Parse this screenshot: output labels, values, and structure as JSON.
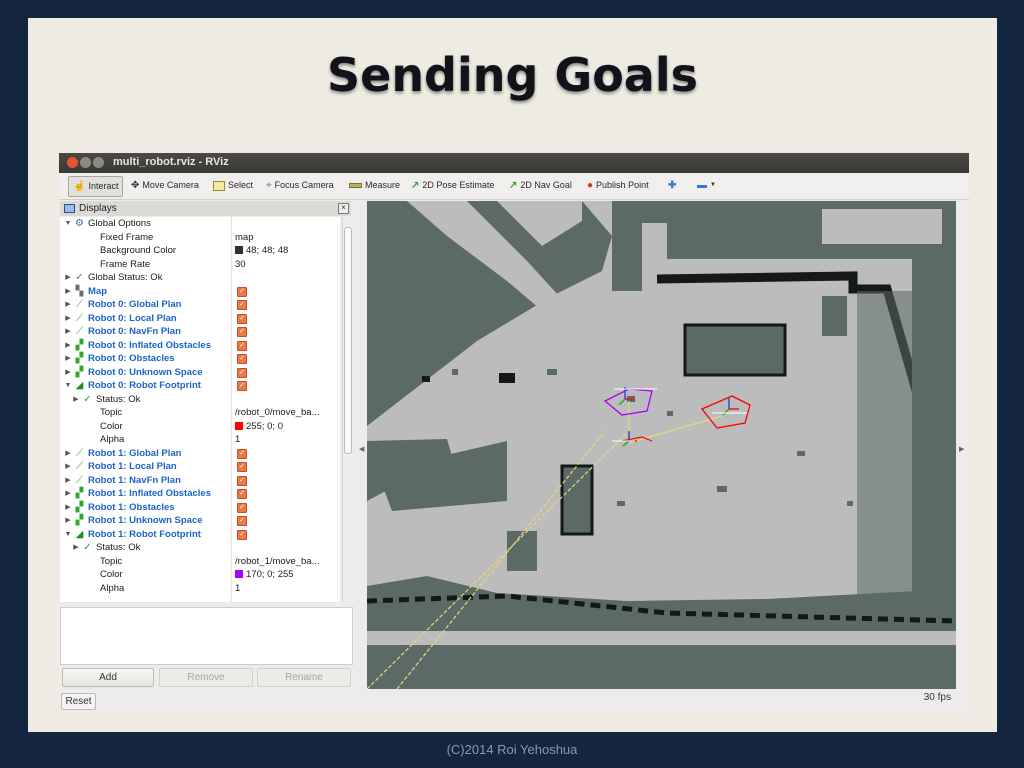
{
  "slide": {
    "title": "Sending Goals",
    "footer": "(C)2014 Roi Yehoshua"
  },
  "window": {
    "title": "multi_robot.rviz - RViz"
  },
  "toolbar": {
    "interact": "Interact",
    "move_camera": "Move Camera",
    "select": "Select",
    "focus_camera": "Focus Camera",
    "measure": "Measure",
    "pose_estimate": "2D Pose Estimate",
    "nav_goal": "2D Nav Goal",
    "publish_point": "Publish Point"
  },
  "displays": {
    "header": "Displays",
    "rows": [
      {
        "label": "Global Options",
        "icon": "gear-icon",
        "indent": 0,
        "arrow": "down",
        "blue": false
      },
      {
        "label": "Fixed Frame",
        "value": "map",
        "indent": 2
      },
      {
        "label": "Background Color",
        "value": "48; 48; 48",
        "swatch": "#303030",
        "indent": 2
      },
      {
        "label": "Frame Rate",
        "value": "30",
        "indent": 2
      },
      {
        "label": "Global Status: Ok",
        "icon": "check-icon",
        "indent": 0,
        "arrow": "right"
      },
      {
        "label": "Map",
        "icon": "map-icon",
        "indent": 0,
        "arrow": "right",
        "blue": true,
        "checked": true
      },
      {
        "label": "Robot 0: Global Plan",
        "icon": "path-icon",
        "indent": 0,
        "arrow": "right",
        "blue": true,
        "checked": true
      },
      {
        "label": "Robot 0: Local Plan",
        "icon": "path-icon",
        "indent": 0,
        "arrow": "right",
        "blue": true,
        "checked": true
      },
      {
        "label": "Robot 0: NavFn Plan",
        "icon": "path-icon",
        "indent": 0,
        "arrow": "right",
        "blue": true,
        "checked": true
      },
      {
        "label": "Robot 0: Inflated Obstacles",
        "icon": "grid-cells-icon",
        "indent": 0,
        "arrow": "right",
        "blue": true,
        "checked": true
      },
      {
        "label": "Robot 0: Obstacles",
        "icon": "grid-cells-icon",
        "indent": 0,
        "arrow": "right",
        "blue": true,
        "checked": true
      },
      {
        "label": "Robot 0: Unknown Space",
        "icon": "grid-cells-icon",
        "indent": 0,
        "arrow": "right",
        "blue": true,
        "checked": true
      },
      {
        "label": "Robot 0: Robot Footprint",
        "icon": "polygon-icon",
        "indent": 0,
        "arrow": "down",
        "blue": true,
        "checked": true
      },
      {
        "label": "Status: Ok",
        "icon": "check-icon",
        "indent": 1,
        "arrow": "right"
      },
      {
        "label": "Topic",
        "value": "/robot_0/move_ba...",
        "indent": 2
      },
      {
        "label": "Color",
        "value": "255; 0; 0",
        "swatch": "#ff0000",
        "indent": 2
      },
      {
        "label": "Alpha",
        "value": "1",
        "indent": 2
      },
      {
        "label": "Robot 1: Global Plan",
        "icon": "path-icon",
        "indent": 0,
        "arrow": "right",
        "blue": true,
        "checked": true
      },
      {
        "label": "Robot 1: Local Plan",
        "icon": "path-icon",
        "indent": 0,
        "arrow": "right",
        "blue": true,
        "checked": true
      },
      {
        "label": "Robot 1: NavFn Plan",
        "icon": "path-icon",
        "indent": 0,
        "arrow": "right",
        "blue": true,
        "checked": true
      },
      {
        "label": "Robot 1: Inflated Obstacles",
        "icon": "grid-cells-icon",
        "indent": 0,
        "arrow": "right",
        "blue": true,
        "checked": true
      },
      {
        "label": "Robot 1: Obstacles",
        "icon": "grid-cells-icon",
        "indent": 0,
        "arrow": "right",
        "blue": true,
        "checked": true
      },
      {
        "label": "Robot 1: Unknown Space",
        "icon": "grid-cells-icon",
        "indent": 0,
        "arrow": "right",
        "blue": true,
        "checked": true
      },
      {
        "label": "Robot 1: Robot Footprint",
        "icon": "polygon-icon",
        "indent": 0,
        "arrow": "down",
        "blue": true,
        "checked": true
      },
      {
        "label": "Status: Ok",
        "icon": "check-icon",
        "indent": 1,
        "arrow": "right"
      },
      {
        "label": "Topic",
        "value": "/robot_1/move_ba...",
        "indent": 2
      },
      {
        "label": "Color",
        "value": "170; 0; 255",
        "swatch": "#aa00ff",
        "indent": 2
      },
      {
        "label": "Alpha",
        "value": "1",
        "indent": 2
      }
    ]
  },
  "buttons": {
    "add": "Add",
    "remove": "Remove",
    "rename": "Rename",
    "reset": "Reset"
  },
  "status": {
    "fps": "30 fps"
  },
  "colors": {
    "robot_0_footprint": "#ff0000",
    "robot_1_footprint": "#aa00ff",
    "plan_line": "#e5d97a"
  }
}
